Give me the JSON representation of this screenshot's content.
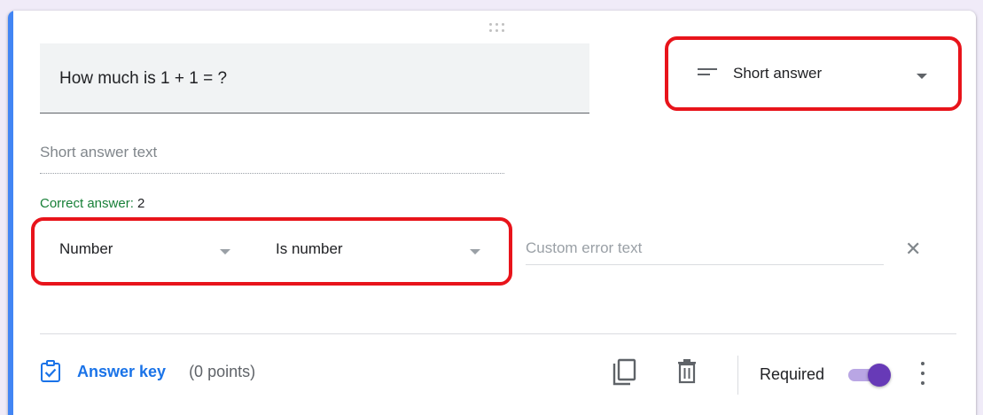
{
  "question": {
    "title": "How much is 1 + 1 = ?"
  },
  "question_type": {
    "label": "Short answer",
    "icon": "short-text-icon"
  },
  "answer_preview": {
    "placeholder": "Short answer text"
  },
  "correct_answer": {
    "label": "Correct answer:",
    "value": "2"
  },
  "validation": {
    "type_value": "Number",
    "condition_value": "Is number",
    "error_placeholder": "Custom error text"
  },
  "footer": {
    "answer_key_label": "Answer key",
    "points_label": "(0 points)",
    "required_label": "Required",
    "required_on": true
  },
  "colors": {
    "accent": "#4285f4",
    "link_blue": "#1a73e8",
    "toggle_purple": "#673ab7",
    "correct_green": "#188038",
    "highlight_red": "#e8141b"
  }
}
